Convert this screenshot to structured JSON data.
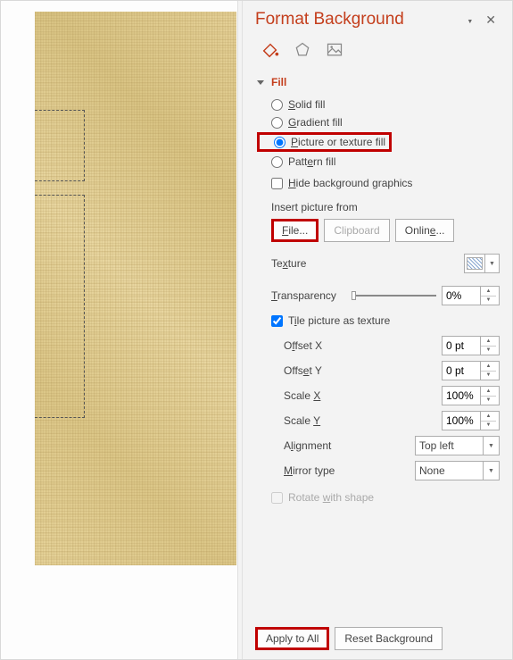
{
  "panel": {
    "title": "Format Background"
  },
  "fill": {
    "section_label": "Fill",
    "solid": "Solid fill",
    "gradient": "Gradient fill",
    "picture_texture": "Picture or texture fill",
    "pattern": "Pattern fill",
    "hide_bg": "Hide background graphics",
    "insert_from": "Insert picture from",
    "file_btn": "File...",
    "clipboard_btn": "Clipboard",
    "online_btn": "Online...",
    "texture_label": "Texture",
    "transparency_label": "Transparency",
    "transparency_value": "0%",
    "tile_label": "Tile picture as texture",
    "offset_x_label": "Offset X",
    "offset_x_value": "0 pt",
    "offset_y_label": "Offset Y",
    "offset_y_value": "0 pt",
    "scale_x_label": "Scale X",
    "scale_x_value": "100%",
    "scale_y_label": "Scale Y",
    "scale_y_value": "100%",
    "alignment_label": "Alignment",
    "alignment_value": "Top left",
    "mirror_label": "Mirror type",
    "mirror_value": "None",
    "rotate_label": "Rotate with shape"
  },
  "footer": {
    "apply_all": "Apply to All",
    "reset": "Reset Background"
  }
}
